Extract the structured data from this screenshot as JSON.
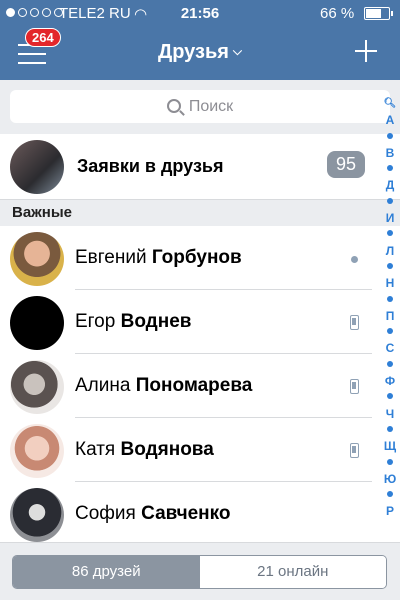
{
  "status_bar": {
    "carrier": "TELE2 RU",
    "time": "21:56",
    "battery": "66 %",
    "battery_level": 0.66
  },
  "nav": {
    "badge": "264",
    "title": "Друзья"
  },
  "search": {
    "placeholder": "Поиск"
  },
  "requests": {
    "label": "Заявки в друзья",
    "count": "95"
  },
  "section_title": "Важные",
  "friends": [
    {
      "first": "Евгений",
      "last": "Горбунов",
      "status": "online"
    },
    {
      "first": "Егор",
      "last": "Воднев",
      "status": "mobile"
    },
    {
      "first": "Алина",
      "last": "Пономарева",
      "status": "mobile"
    },
    {
      "first": "Катя",
      "last": "Водянова",
      "status": "mobile"
    },
    {
      "first": "София",
      "last": "Савченко",
      "status": "none"
    }
  ],
  "index_letters": [
    "•",
    "А",
    "•",
    "В",
    "•",
    "Д",
    "•",
    "И",
    "•",
    "Л",
    "•",
    "Н",
    "•",
    "П",
    "•",
    "С",
    "•",
    "Ф",
    "•",
    "Ч",
    "•",
    "Щ",
    "•",
    "Ю",
    "•",
    "Р"
  ],
  "tabs": {
    "all": "86 друзей",
    "online": "21 онлайн"
  },
  "colors": {
    "header": "#4a76a8",
    "badge": "#e3262b",
    "index": "#2f7fd6"
  }
}
